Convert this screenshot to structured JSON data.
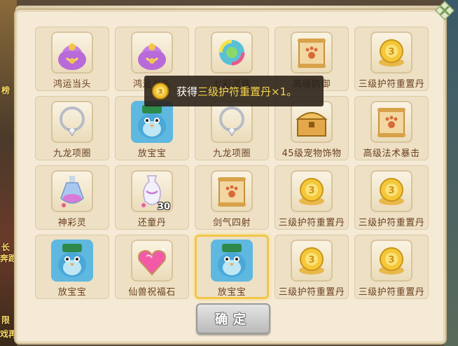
{
  "background": {
    "left_texts": [
      "榜",
      "长",
      "奔跑",
      "限",
      "戏再"
    ]
  },
  "toast": {
    "prefix": "获得",
    "item": "三级护符重置丹",
    "suffix": "×1。",
    "item_color": "#f5d44a"
  },
  "items": [
    {
      "label": "鸿运当头",
      "icon": "lucky-bag-icon"
    },
    {
      "label": "鸿运当头",
      "icon": "lucky-bag-icon"
    },
    {
      "label": "七彩灵珠",
      "icon": "rainbow-orb-icon"
    },
    {
      "label": "高级防御",
      "icon": "paw-scroll-icon"
    },
    {
      "label": "三级护符重置丹",
      "icon": "gold-coin-icon"
    },
    {
      "label": "九龙项圈",
      "icon": "necklace-icon"
    },
    {
      "label": "放宝宝",
      "icon": "bird-pet-icon"
    },
    {
      "label": "九龙项圈",
      "icon": "necklace-icon"
    },
    {
      "label": "45级宠物饰物",
      "icon": "treasure-chest-icon"
    },
    {
      "label": "高级法术暴击",
      "icon": "paw-scroll-icon"
    },
    {
      "label": "神彩灵",
      "icon": "potion-bottle-icon"
    },
    {
      "label": "还童丹",
      "icon": "vase-icon",
      "qty": "30"
    },
    {
      "label": "剑气四射",
      "icon": "paw-scroll-icon"
    },
    {
      "label": "三级护符重置丹",
      "icon": "gold-coin-icon"
    },
    {
      "label": "三级护符重置丹",
      "icon": "gold-coin-icon"
    },
    {
      "label": "放宝宝",
      "icon": "bird-pet-icon"
    },
    {
      "label": "仙兽祝福石",
      "icon": "heart-gem-icon"
    },
    {
      "label": "放宝宝",
      "icon": "bird-pet-icon",
      "selected": true
    },
    {
      "label": "三级护符重置丹",
      "icon": "gold-coin-icon"
    },
    {
      "label": "三级护符重置丹",
      "icon": "gold-coin-icon"
    }
  ],
  "confirm_label": "确定"
}
